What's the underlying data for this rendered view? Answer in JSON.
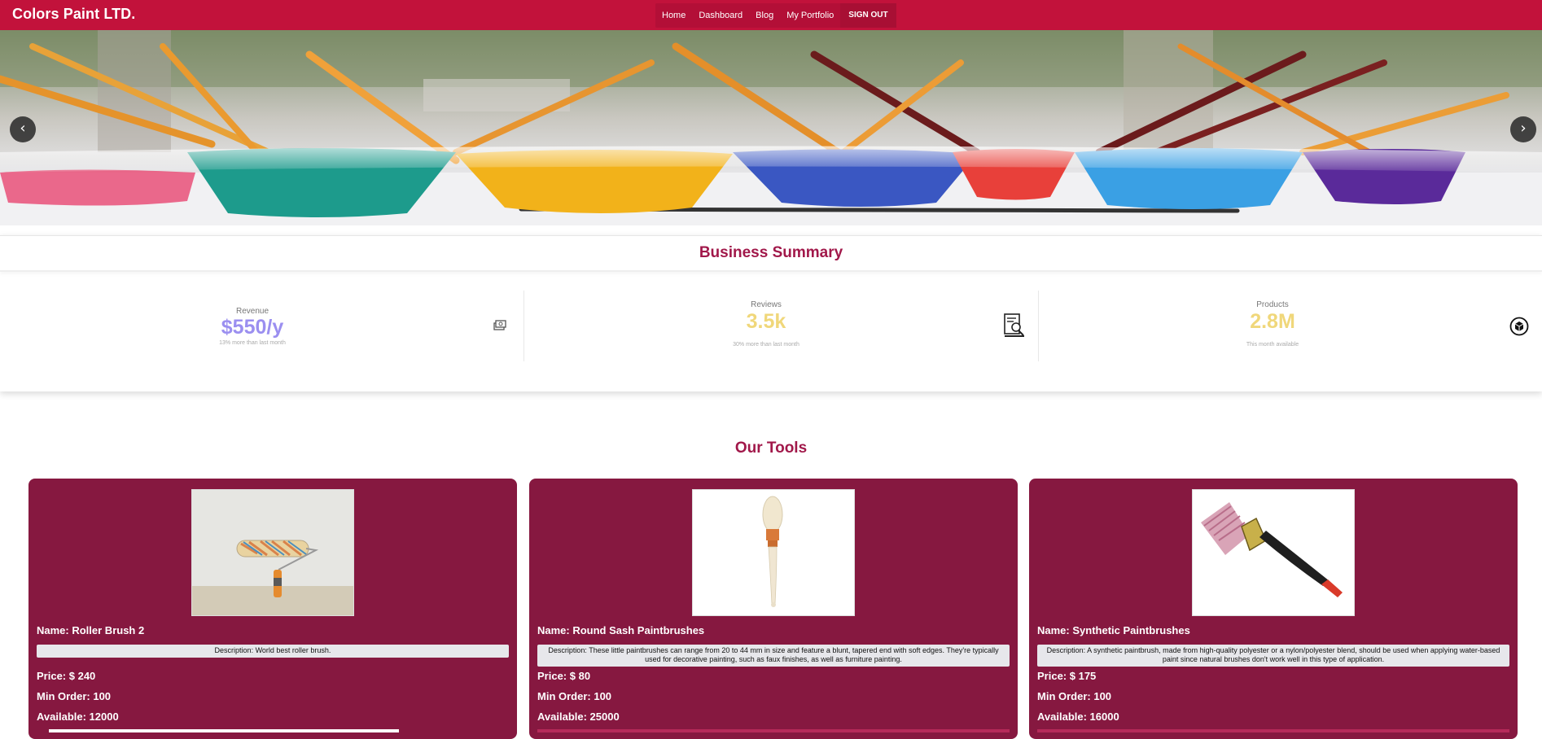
{
  "navbar": {
    "brand": "Colors Paint LTD.",
    "links": [
      "Home",
      "Dashboard",
      "Blog",
      "My Portfolio"
    ],
    "signout": "SIGN OUT",
    "color": "#c2123b"
  },
  "hero": {
    "prev_icon": "chevron-left-icon",
    "next_icon": "chevron-right-icon",
    "prev_label": "‹",
    "next_label": "›"
  },
  "summary": {
    "title": "Business Summary",
    "stats": [
      {
        "label": "Revenue",
        "value": "$550/y",
        "sub": "13% more than last month",
        "color": "#9b8ff0",
        "icon": "money-icon"
      },
      {
        "label": "Reviews",
        "value": "3.5k",
        "sub": "30% more than last month",
        "color": "#f0d77a",
        "icon": "document-search-icon"
      },
      {
        "label": "Products",
        "value": "2.8M",
        "sub": "This month available",
        "color": "#f0d77a",
        "icon": "box-icon"
      }
    ]
  },
  "tools": {
    "title": "Our Tools",
    "items": [
      {
        "name": "Name: Roller Brush 2",
        "description": "Description: World best roller brush.",
        "price": "Price: $ 240",
        "min_order": "Min Order: 100",
        "available": "Available: 12000"
      },
      {
        "name": "Name: Round Sash Paintbrushes",
        "description": "Description: These little paintbrushes can range from 20 to 44 mm in size and feature a blunt, tapered end with soft edges. They're typically used for decorative painting, such as faux finishes, as well as furniture painting.",
        "price": "Price: $ 80",
        "min_order": "Min Order: 100",
        "available": "Available: 25000"
      },
      {
        "name": "Name: Synthetic Paintbrushes",
        "description": "Description: A synthetic paintbrush, made from high-quality polyester or a nylon/polyester blend, should be used when applying water-based paint since natural brushes don't work well in this type of application.",
        "price": "Price: $ 175",
        "min_order": "Min Order: 100",
        "available": "Available: 16000"
      }
    ],
    "card_color": "#861840"
  }
}
